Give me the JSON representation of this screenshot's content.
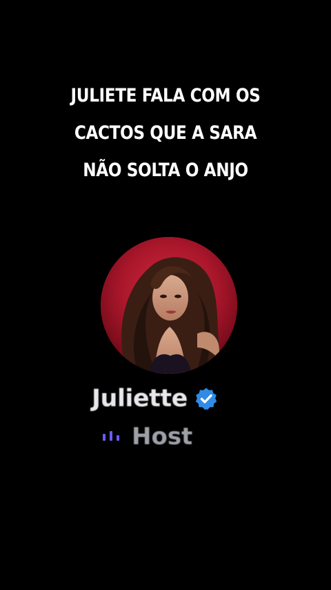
{
  "caption": {
    "lines": [
      "JULIETE FALA COM OS",
      "CACTOS QUE A SARA",
      "NÃO SOLTA O ANJO"
    ]
  },
  "profile": {
    "name": "Juliette",
    "verified": true,
    "role": "Host",
    "avatar_icon": "profile-photo",
    "verified_icon": "verified-badge-icon",
    "role_icon": "equalizer-bars-icon"
  },
  "colors": {
    "background": "#000000",
    "avatar_ring": "#b81c30",
    "verified_blue": "#2f8be6",
    "role_icon_purple": "#6a5cf0",
    "role_text": "#9ea0a8",
    "name_text": "#e8e8ec"
  }
}
